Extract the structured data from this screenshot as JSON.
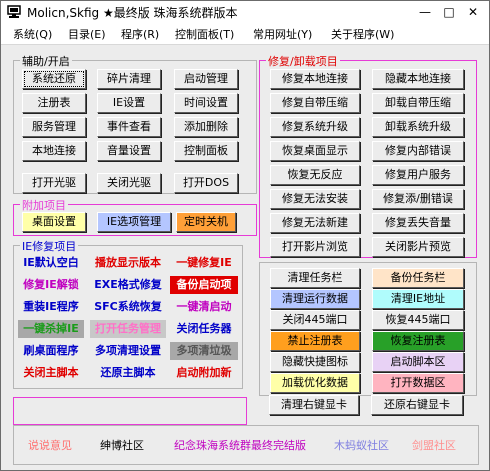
{
  "window": {
    "title": "Molicn,Skfig ★最终版 珠海系统群版本",
    "min": "—",
    "max": "□",
    "close": "✕"
  },
  "menu": [
    "系统(Q)",
    "目录(E)",
    "程序(R)",
    "控制面板(T)",
    "常用网址(Y)",
    "关于程序(W)"
  ],
  "groups": {
    "assist": "辅助/开启",
    "repair": "修复/卸载项目",
    "extra": "附加项目",
    "ie": "IE修复项目"
  },
  "assist_buttons": [
    "系统还原",
    "碎片清理",
    "启动管理",
    "注册表",
    "IE设置",
    "时间设置",
    "服务管理",
    "事件查看",
    "添加删除",
    "本地连接",
    "音量设置",
    "控制面板",
    "打开光驱",
    "关闭光驱",
    "打开DOS"
  ],
  "repair_buttons": [
    "修复本地连接",
    "隐藏本地连接",
    "修复自带压缩",
    "卸载自带压缩",
    "修复系统升级",
    "卸载系统升级",
    "恢复桌面显示",
    "修复内部错误",
    "恢复无反应",
    "修复用户服务",
    "修复无法安装",
    "修复添/删错误",
    "修复无法新建",
    "修复丢失音量",
    "打开影片浏览",
    "关闭影片预览"
  ],
  "extra_buttons": [
    "桌面设置",
    "IE选项管理",
    "定时关机"
  ],
  "ie_items": [
    "IE默认空白",
    "播放显示版本",
    "一键修复IE",
    "修复IE解锁",
    "EXE格式修复",
    "备份启动项",
    "重装IE程序",
    "SFC系统恢复",
    "一键清启动",
    "一键杀掉IE",
    "打开任务管理",
    "关闭任务器",
    "刷桌面程序",
    "多项清理设置",
    "多项清垃圾",
    "关闭主脚本",
    "还原主脚本",
    "启动附加新"
  ],
  "tools": [
    "清理任务栏",
    "备份任务栏",
    "清理运行数据",
    "清理IE地址",
    "关闭445端口",
    "恢复445端口",
    "禁止注册表",
    "恢复注册表",
    "隐藏快捷图标",
    "启动脚本区",
    "加载优化数据",
    "打开数据区",
    "清理右键显卡",
    "还原右键显卡"
  ],
  "bottom": [
    "说说意见",
    "绅博社区",
    "纪念珠海系统群最终完结版",
    "木蚂蚁社区",
    "剑盟社区"
  ],
  "colors": {
    "yellow": "#ffffa8",
    "blue": "#b4c6ff",
    "pink": "#ffc8c8",
    "orange": "#ffa038",
    "beige": "#ffe4c8",
    "cyan": "#b0fcfc",
    "orange2": "#ff9f1e",
    "green": "#28a028",
    "lav": "#e8d2f5",
    "pink2": "#ffb4c0",
    "grey": "#d2d2d2",
    "accent": "#e63bd6"
  }
}
